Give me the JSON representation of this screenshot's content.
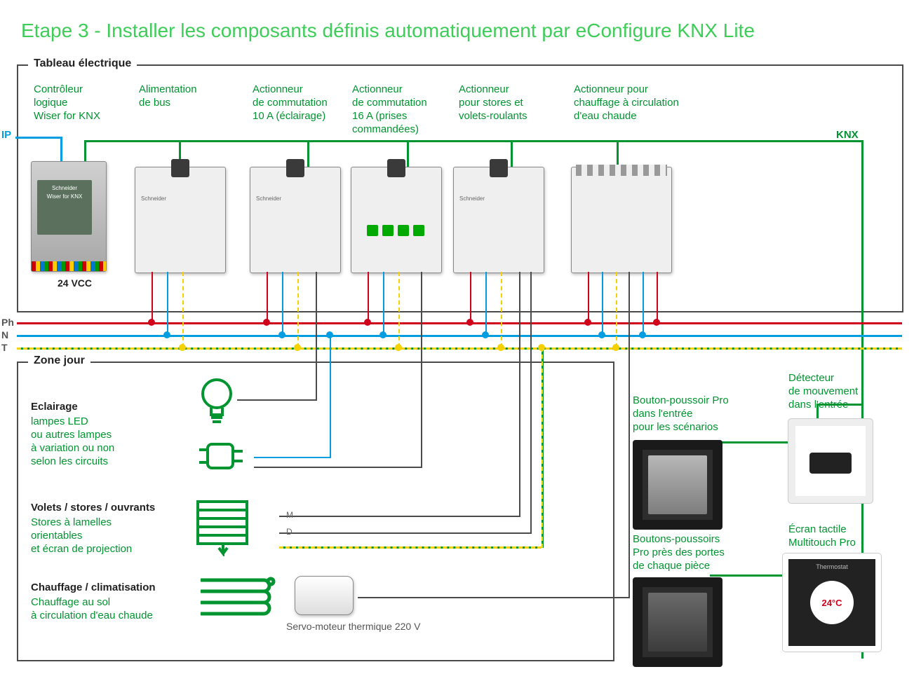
{
  "title": "Etape 3 - Installer les composants définis automatiquement par eConfigure KNX Lite",
  "panels": {
    "top": "Tableau électrique",
    "bottom": "Zone jour"
  },
  "columns": {
    "c1": "Contrôleur\nlogique\nWiser for KNX",
    "c2": "Alimentation\nde bus",
    "c3": "Actionneur\nde commutation\n10 A (éclairage)",
    "c4": "Actionneur\nde commutation\n16 A (prises\ncommandées)",
    "c5": "Actionneur\npour stores et\nvolets-roulants",
    "c6": "Actionneur pour\nchauffage à circulation\nd'eau chaude"
  },
  "bus": {
    "ip": "IP",
    "knx": "KNX",
    "vcc": "24 VCC"
  },
  "rails": {
    "ph": "Ph",
    "n": "N",
    "t": "T"
  },
  "zone": {
    "z1h": "Eclairage",
    "z1": "lampes LED\nou autres lampes\nà variation ou non\nselon les circuits",
    "z2h": "Volets / stores / ouvrants",
    "z2": "Stores à lamelles\norientables\net écran de projection",
    "z3h": "Chauffage / climatisation",
    "z3": "Chauffage au sol\nà circulation d'eau chaude",
    "servo": "Servo-moteur thermique 220 V",
    "m": "M",
    "d": "D"
  },
  "right": {
    "pb1": "Bouton-poussoir Pro\ndans l'entrée\npour les scénarios",
    "pb2": "Boutons-poussoirs\nPro près des portes\nde chaque pièce",
    "det": "Détecteur\nde mouvement\ndans l'entrée",
    "mt": "Écran tactile\nMultitouch Pro"
  },
  "thermo": {
    "label": "Thermostat",
    "value": "24°C"
  }
}
